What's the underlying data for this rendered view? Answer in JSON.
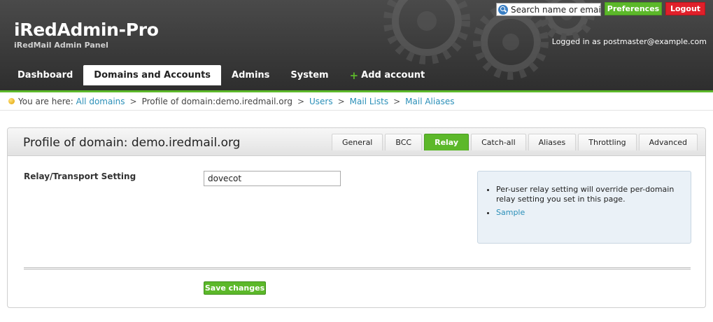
{
  "brand": {
    "title": "iRedAdmin-Pro",
    "subtitle": "iRedMail Admin Panel"
  },
  "search": {
    "placeholder": "Search name or email",
    "icon": "search-icon"
  },
  "header_actions": {
    "preferences": "Preferences",
    "logout": "Logout",
    "logged_in": "Logged in as postmaster@example.com"
  },
  "nav": {
    "items": [
      {
        "label": "Dashboard"
      },
      {
        "label": "Domains and Accounts"
      },
      {
        "label": "Admins"
      },
      {
        "label": "System"
      },
      {
        "label": "Add account"
      }
    ],
    "active": "Domains and Accounts"
  },
  "breadcrumb": {
    "prefix": "You are here:",
    "items": [
      {
        "label": "All domains",
        "link": true
      },
      {
        "label": "Profile of domain:demo.iredmail.org",
        "link": false
      },
      {
        "label": "Users",
        "link": true
      },
      {
        "label": "Mail Lists",
        "link": true
      },
      {
        "label": "Mail Aliases",
        "link": true
      }
    ],
    "separator": ">"
  },
  "panel": {
    "title": "Profile of domain: demo.iredmail.org",
    "tabs": [
      {
        "label": "General"
      },
      {
        "label": "BCC"
      },
      {
        "label": "Relay"
      },
      {
        "label": "Catch-all"
      },
      {
        "label": "Aliases"
      },
      {
        "label": "Throttling"
      },
      {
        "label": "Advanced"
      }
    ],
    "active_tab": "Relay"
  },
  "form": {
    "label": "Relay/Transport Setting",
    "value": "dovecot",
    "save": "Save changes"
  },
  "info": {
    "note": "Per-user relay setting will override per-domain relay setting you set in this page.",
    "sample": "Sample"
  },
  "colors": {
    "accent_green": "#5cb82a",
    "logout_red": "#e0202a",
    "link_blue": "#2a8fb8"
  }
}
